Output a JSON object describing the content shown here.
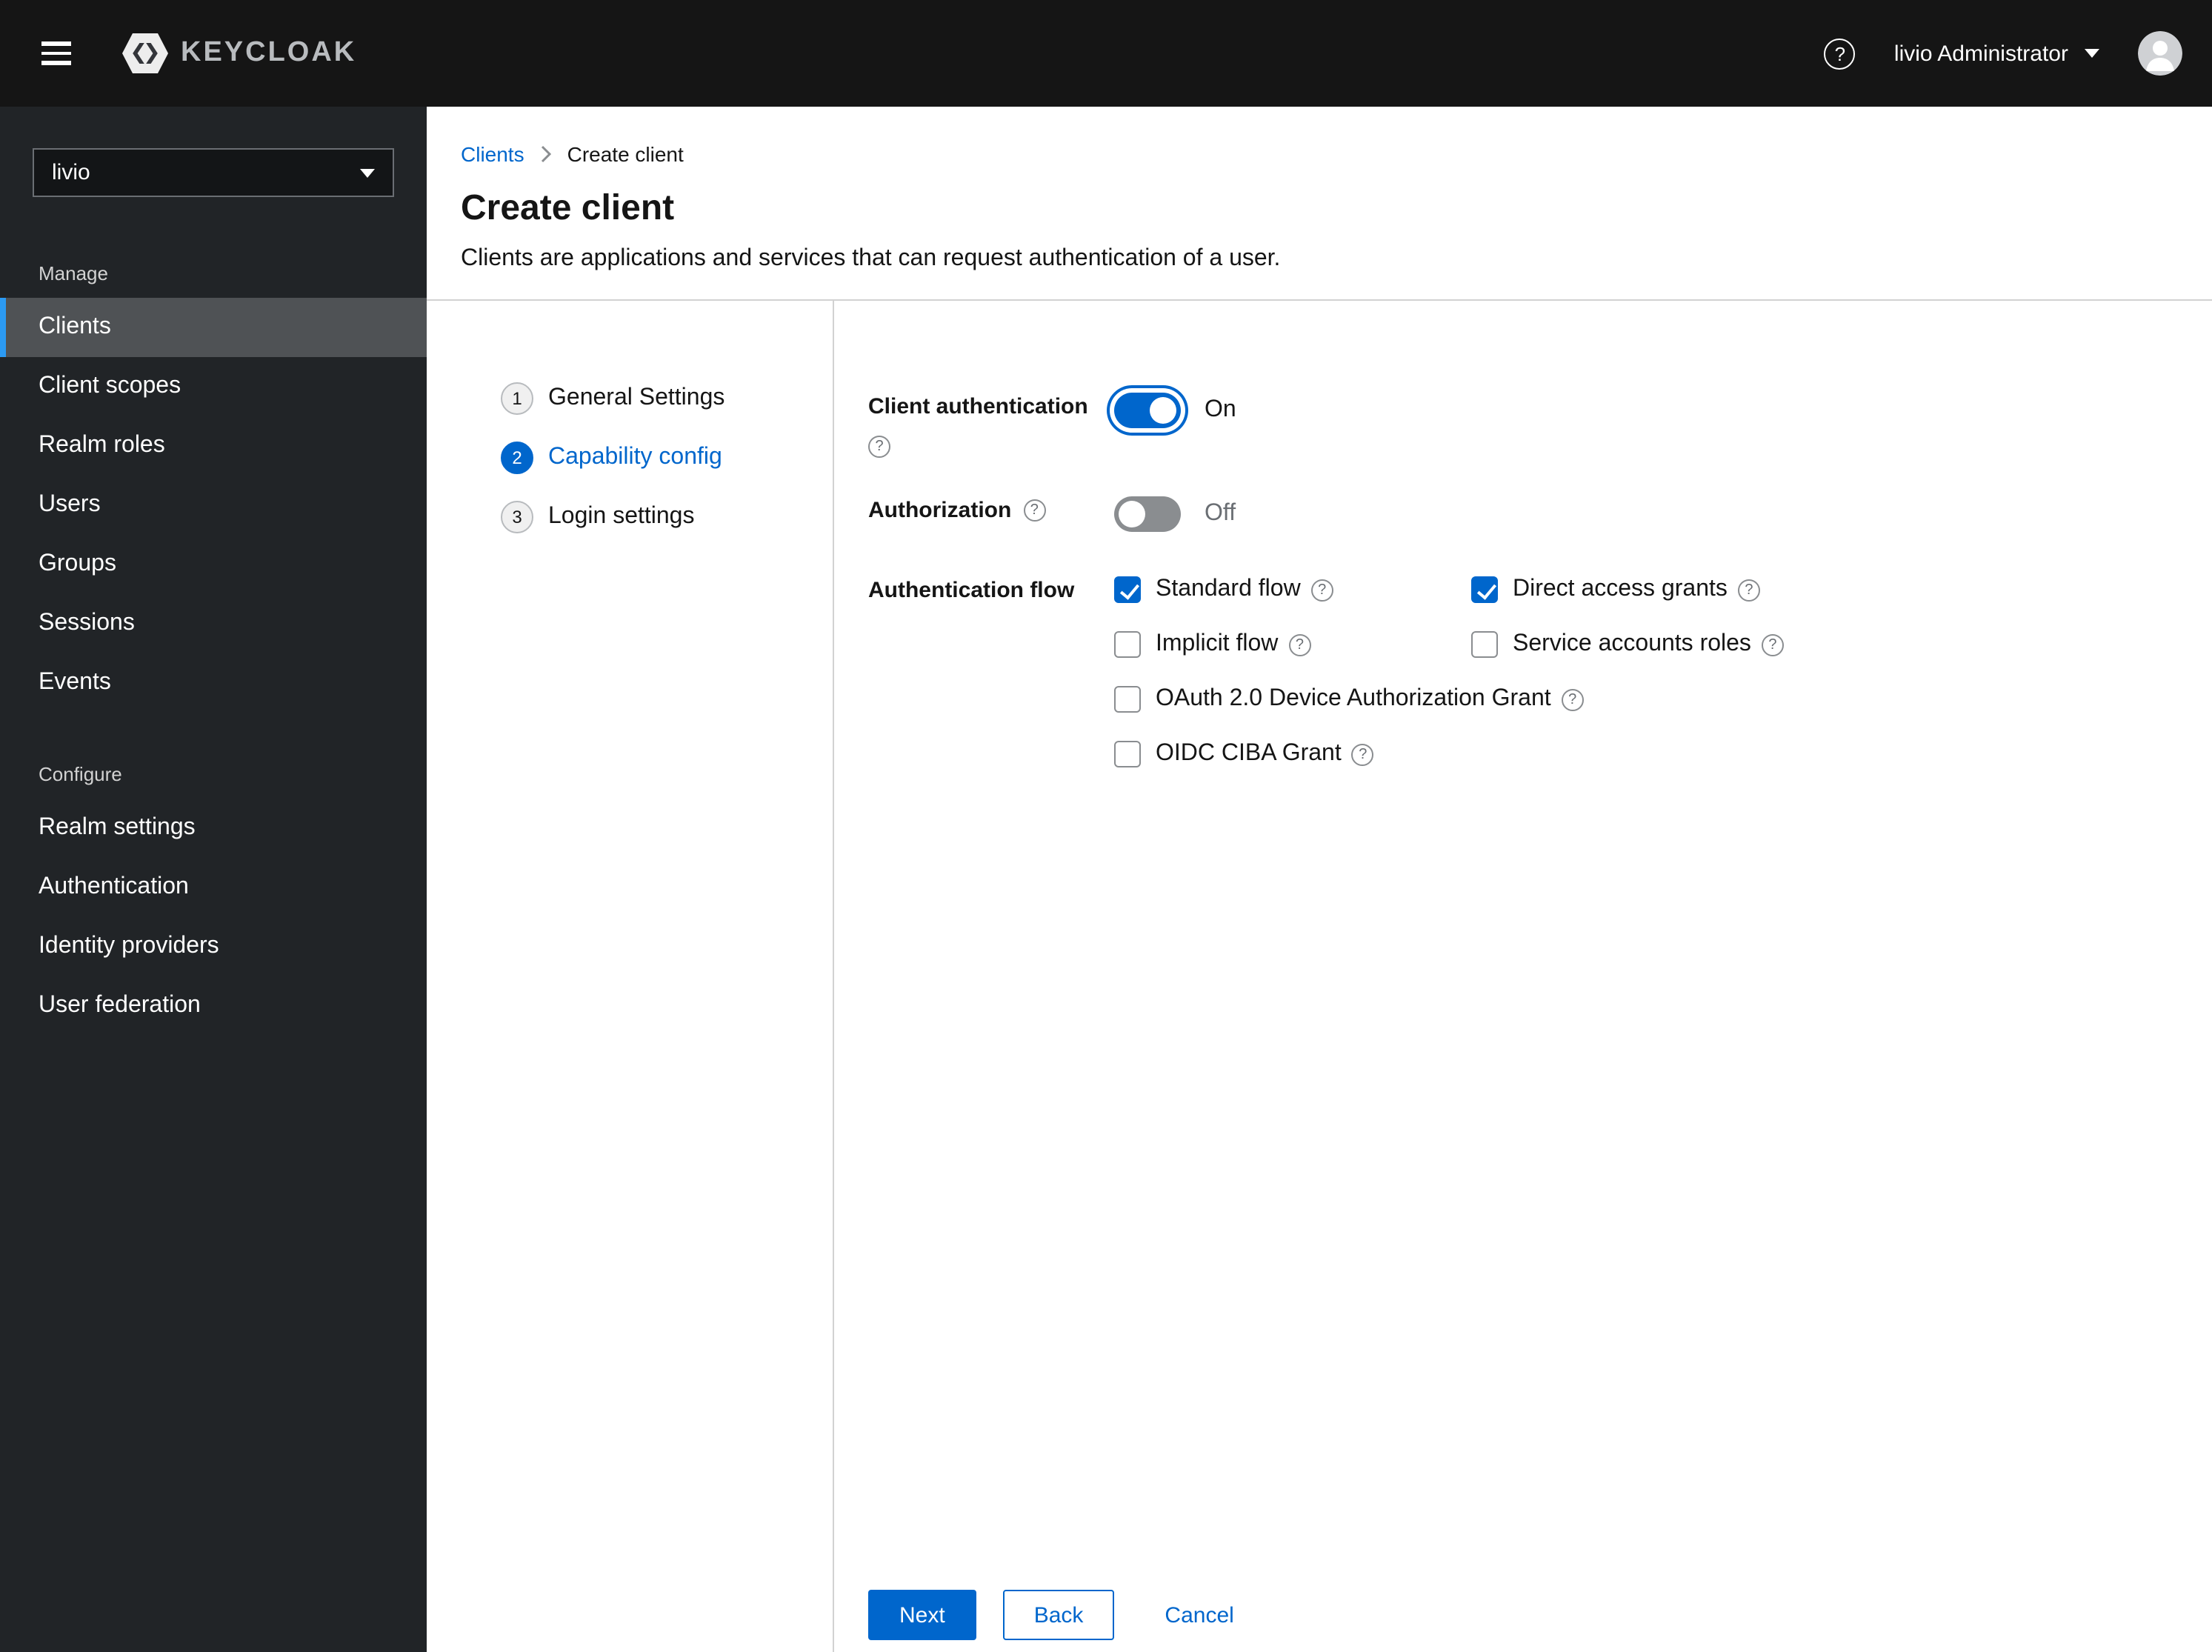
{
  "colors": {
    "accent": "#0066cc",
    "masthead-bg": "#151515",
    "sidebar-bg": "#212427",
    "sidebar-selected-bg": "#4f5255",
    "sidebar-selected-stripe": "#2b9af3",
    "divider": "#d2d2d2",
    "text": "#151515",
    "muted": "#6a6e73"
  },
  "icons": {
    "menu": "hamburger",
    "brand": "keycloak-hexagon-chevrons",
    "help": "question-circle",
    "caret_down": "▾",
    "breadcrumb_separator": "›",
    "avatar": "user-circle"
  },
  "masthead": {
    "brand_text": "KEYCLOAK",
    "user_label": "livio Administrator"
  },
  "sidebar": {
    "realm_selector": {
      "value": "livio"
    },
    "sections": [
      {
        "label": "Manage",
        "items": [
          {
            "label": "Clients",
            "selected": true
          },
          {
            "label": "Client scopes"
          },
          {
            "label": "Realm roles"
          },
          {
            "label": "Users"
          },
          {
            "label": "Groups"
          },
          {
            "label": "Sessions"
          },
          {
            "label": "Events"
          }
        ]
      },
      {
        "label": "Configure",
        "items": [
          {
            "label": "Realm settings"
          },
          {
            "label": "Authentication"
          },
          {
            "label": "Identity providers"
          },
          {
            "label": "User federation"
          }
        ]
      }
    ]
  },
  "breadcrumb": {
    "parent": "Clients",
    "current": "Create client"
  },
  "page": {
    "title": "Create client",
    "description": "Clients are applications and services that can request authentication of a user."
  },
  "wizard": {
    "steps": [
      {
        "number": "1",
        "label": "General Settings",
        "state": "visited"
      },
      {
        "number": "2",
        "label": "Capability config",
        "state": "current"
      },
      {
        "number": "3",
        "label": "Login settings",
        "state": "pending"
      }
    ]
  },
  "form": {
    "client_authentication": {
      "label": "Client authentication",
      "enabled": true,
      "value": "On"
    },
    "authorization": {
      "label": "Authorization",
      "enabled": false,
      "value": "Off"
    },
    "authentication_flow": {
      "label": "Authentication flow",
      "options": [
        {
          "label": "Standard flow",
          "checked": true
        },
        {
          "label": "Direct access grants",
          "checked": true
        },
        {
          "label": "Implicit flow",
          "checked": false
        },
        {
          "label": "Service accounts roles",
          "checked": false
        },
        {
          "label": "OAuth 2.0 Device Authorization Grant",
          "checked": false
        },
        {
          "label": "OIDC CIBA Grant",
          "checked": false
        }
      ]
    }
  },
  "footer": {
    "next": "Next",
    "back": "Back",
    "cancel": "Cancel"
  }
}
